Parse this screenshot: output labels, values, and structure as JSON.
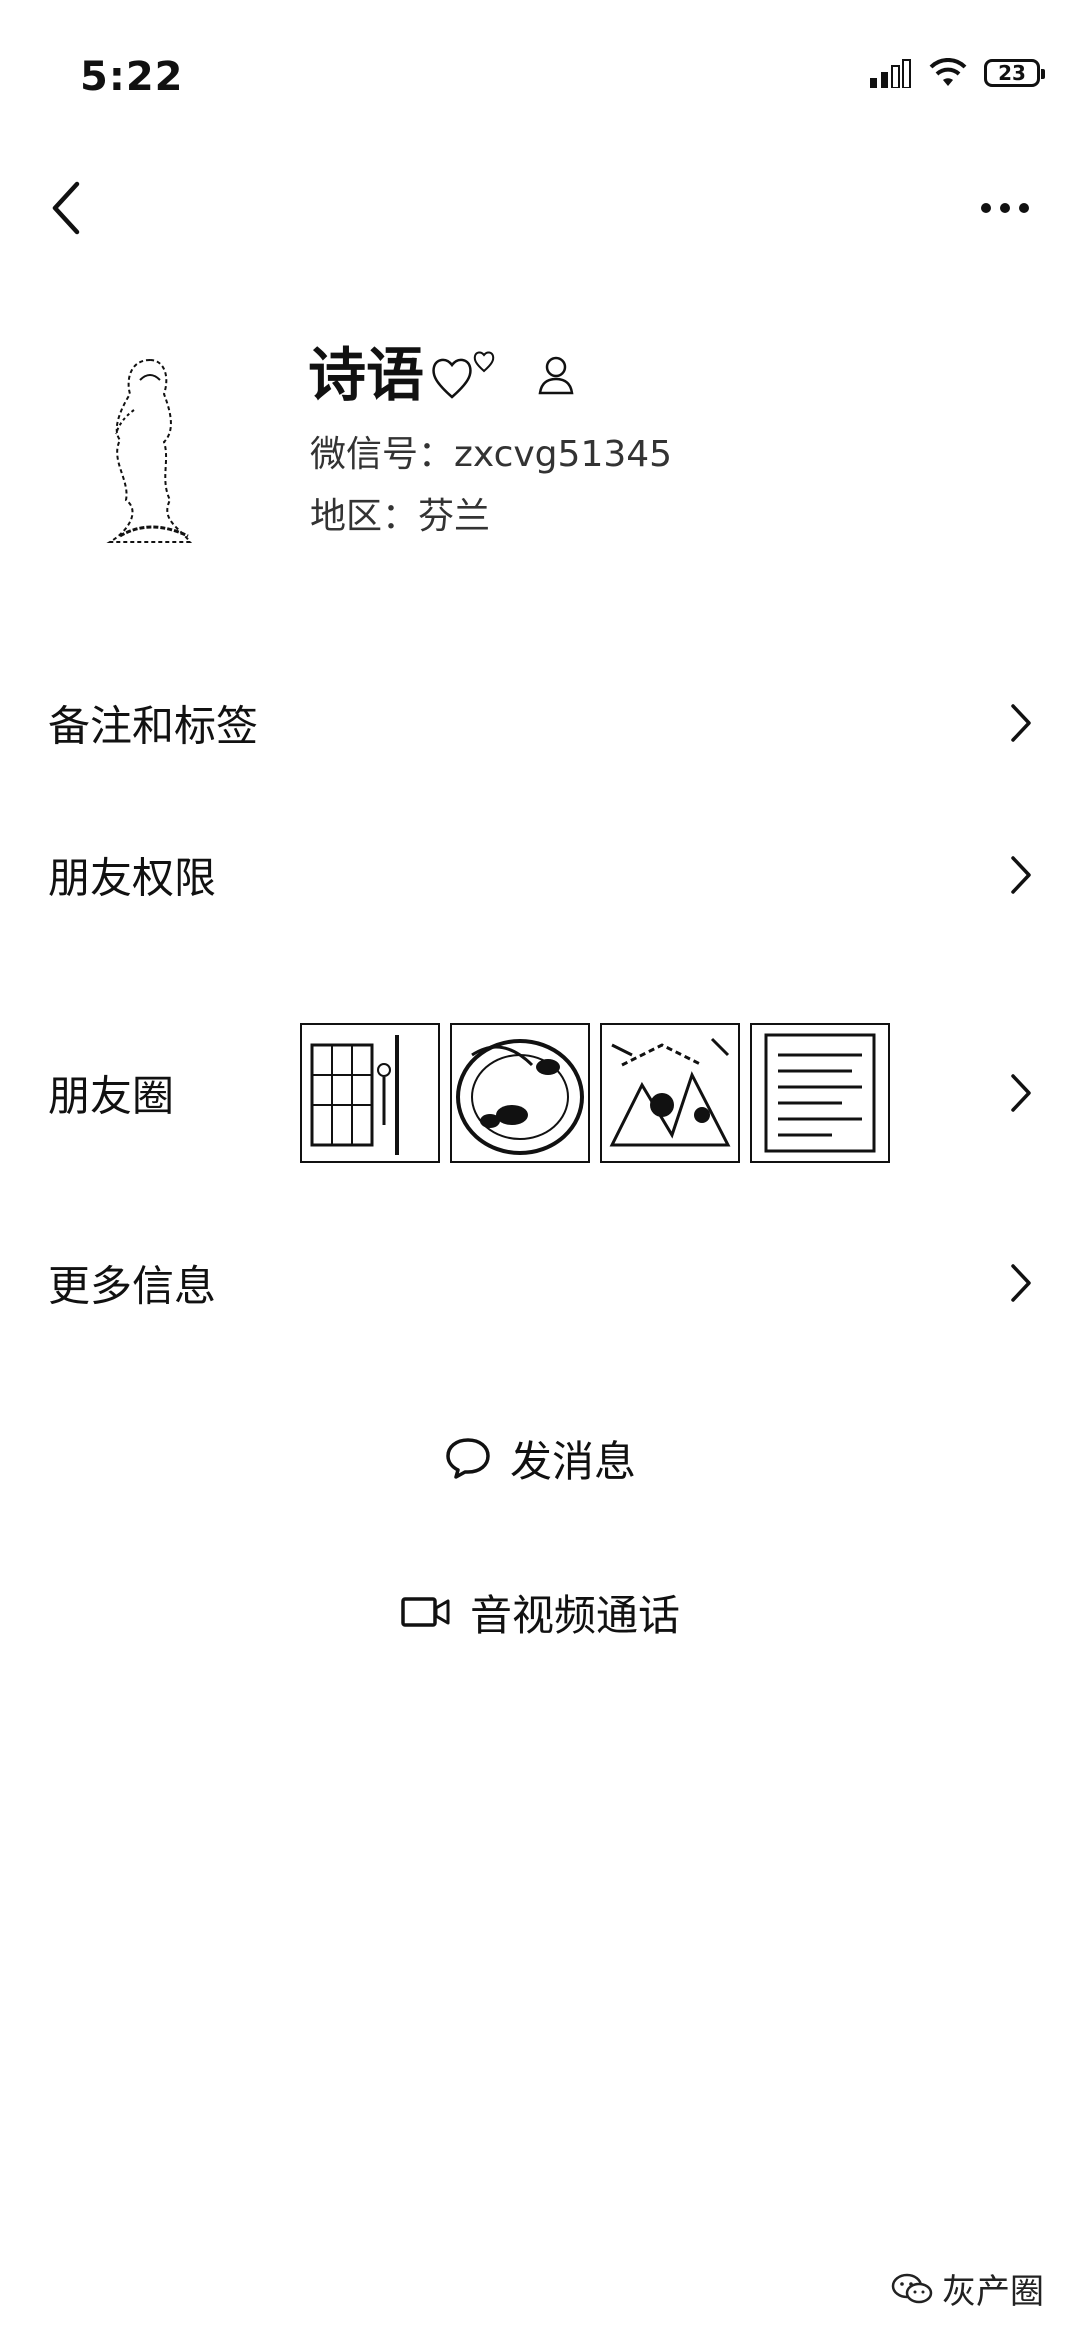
{
  "status_bar": {
    "time": "5:22",
    "battery": "23",
    "icons": [
      "signal-icon",
      "wifi-icon",
      "battery-icon"
    ]
  },
  "nav": {
    "back_icon": "chevron-left-icon",
    "more_icon": "more-dots-icon"
  },
  "profile": {
    "name": "诗语",
    "wechat_id_label": "微信号：",
    "wechat_id": "zxcvg51345",
    "region_label": "地区：",
    "region": "芬兰",
    "decorations": [
      "hearts-icon",
      "contact-person-icon"
    ]
  },
  "rows": {
    "remark": "备注和标签",
    "permissions": "朋友权限",
    "moments": "朋友圈",
    "more_info": "更多信息"
  },
  "actions": {
    "send_message": "发消息",
    "video_call": "音视频通话"
  },
  "watermark": {
    "text": "灰产圈",
    "icon": "wechat-channel-icon"
  }
}
